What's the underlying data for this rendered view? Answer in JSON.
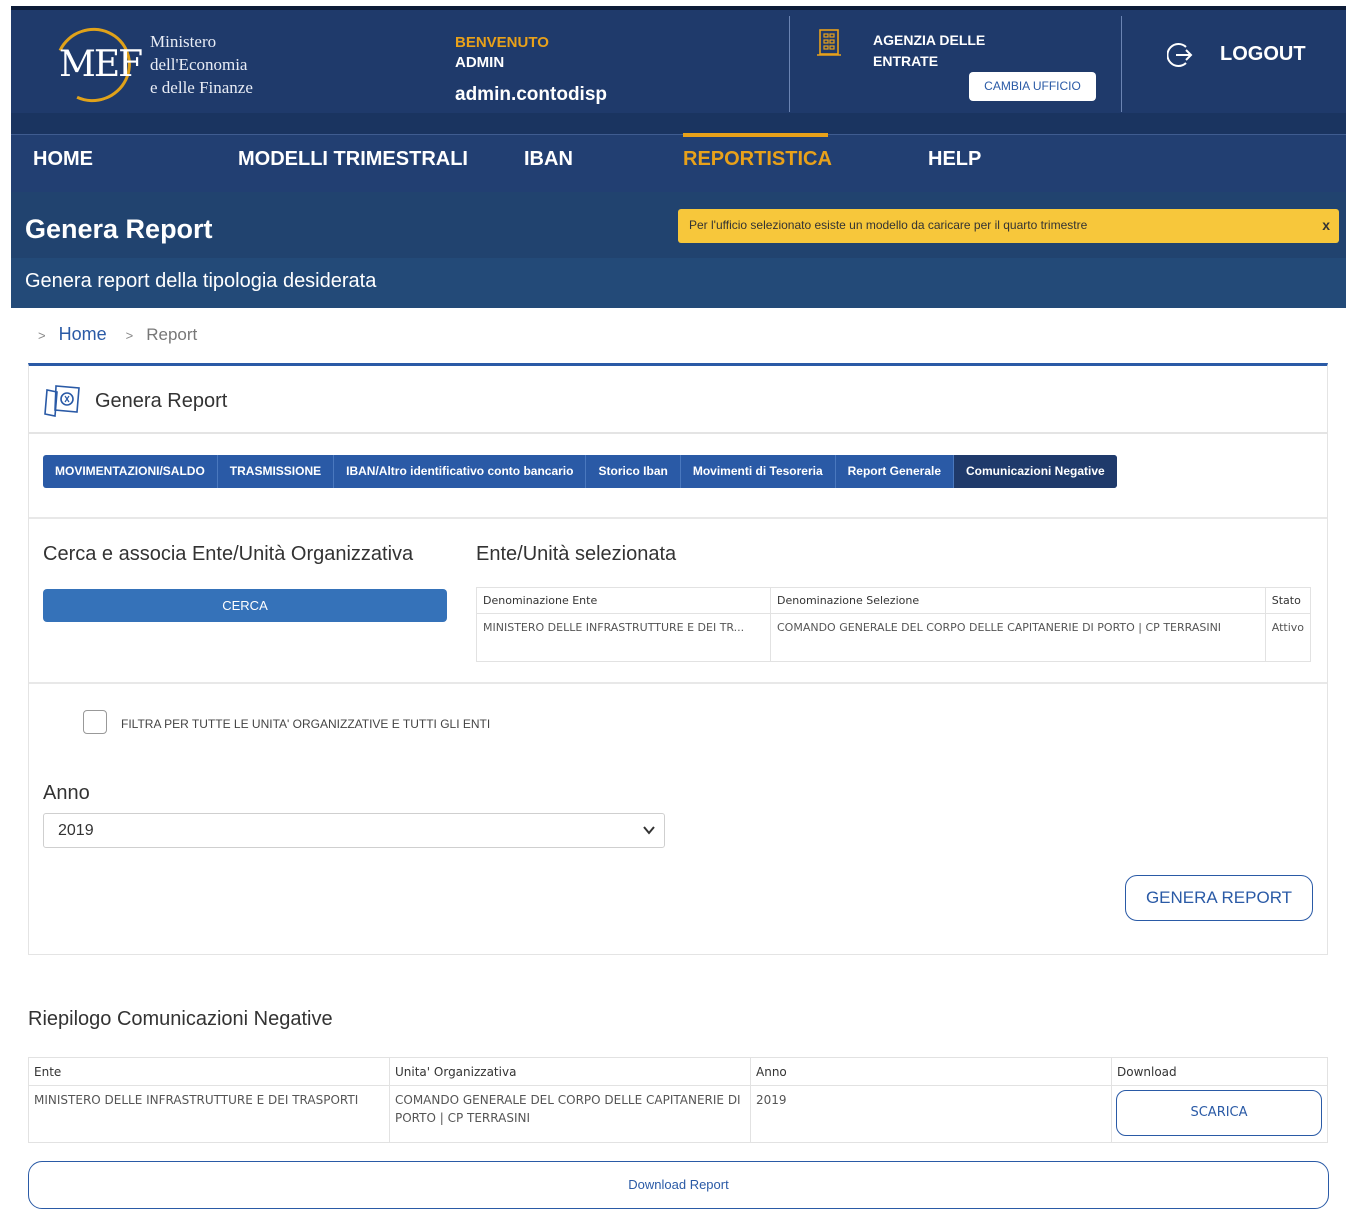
{
  "header": {
    "logo_text": "MEF",
    "ministry_lines": [
      "Ministero",
      "dell'Economia",
      "e delle Finanze"
    ],
    "welcome_label": "BENVENUTO",
    "user_role": "ADMIN",
    "username": "admin.contodisp",
    "agency_lines": [
      "AGENZIA DELLE",
      "ENTRATE"
    ],
    "change_office_label": "CAMBIA UFFICIO",
    "logout_label": "LOGOUT",
    "brand_color": "#1f3a6b",
    "accent_color": "#e8a11a"
  },
  "nav": {
    "items": [
      {
        "label": "HOME",
        "active": false
      },
      {
        "label": "MODELLI TRIMESTRALI",
        "active": false
      },
      {
        "label": "IBAN",
        "active": false
      },
      {
        "label": "REPORTISTICA",
        "active": true
      },
      {
        "label": "HELP",
        "active": false
      }
    ]
  },
  "page": {
    "title": "Genera Report",
    "subtitle": "Genera report della tipologia desiderata",
    "alert_text": "Per l'ufficio selezionato esiste un modello da caricare per il quarto trimestre",
    "alert_close": "x"
  },
  "breadcrumb": {
    "separator": ">",
    "home": "Home",
    "current": "Report"
  },
  "card": {
    "title": "Genera Report",
    "tabs": [
      {
        "label": "MOVIMENTAZIONI/SALDO",
        "active": false
      },
      {
        "label": "TRASMISSIONE",
        "active": false
      },
      {
        "label": "IBAN/Altro identificativo conto bancario",
        "active": false
      },
      {
        "label": "Storico Iban",
        "active": false
      },
      {
        "label": "Movimenti di Tesoreria",
        "active": false
      },
      {
        "label": "Report Generale",
        "active": false
      },
      {
        "label": "Comunicazioni Negative",
        "active": true
      }
    ],
    "search_title": "Cerca e associa Ente/Unità Organizzativa",
    "search_button": "CERCA",
    "selected_title": "Ente/Unità selezionata",
    "selected_table": {
      "headers": [
        "Denominazione Ente",
        "Denominazione Selezione",
        "Stato"
      ],
      "rows": [
        [
          "MINISTERO DELLE INFRASTRUTTURE E DEI TR...",
          "COMANDO GENERALE DEL CORPO DELLE CAPITANERIE DI PORTO | CP TERRASINI",
          "Attivo"
        ]
      ]
    },
    "filter_label": "FILTRA PER TUTTE LE UNITA' ORGANIZZATIVE E TUTTI GLI ENTI",
    "filter_checked": false,
    "year_label": "Anno",
    "year_value": "2019",
    "generate_button": "GENERA REPORT"
  },
  "summary": {
    "title": "Riepilogo Comunicazioni Negative",
    "headers": [
      "Ente",
      "Unita' Organizzativa",
      "Anno",
      "Download"
    ],
    "rows": [
      [
        "MINISTERO DELLE INFRASTRUTTURE E DEI TRASPORTI",
        "COMANDO GENERALE DEL CORPO DELLE CAPITANERIE DI PORTO | CP TERRASINI",
        "2019",
        "SCARICA"
      ]
    ],
    "download_report": "Download Report"
  }
}
